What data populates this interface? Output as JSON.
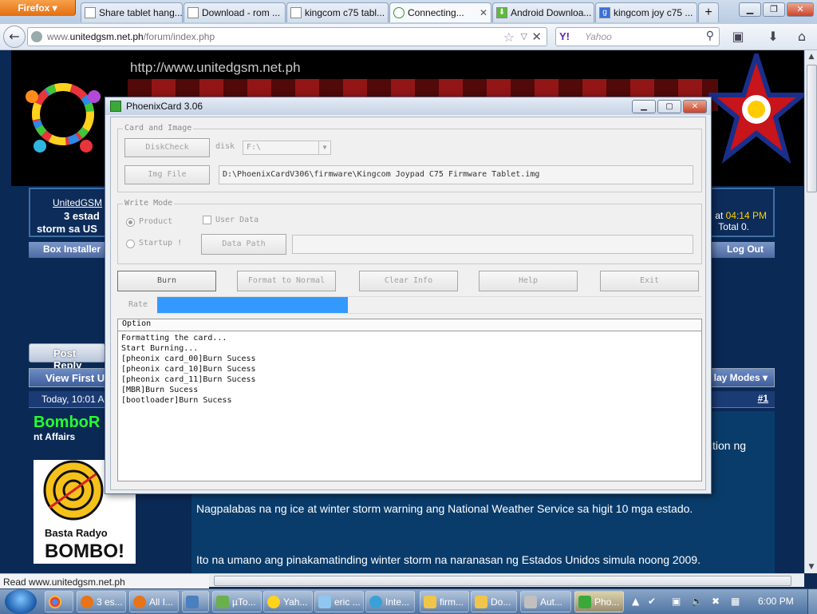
{
  "browser": {
    "app_button": "Firefox ▾",
    "tabs": [
      {
        "label": "Share tablet hang..."
      },
      {
        "label": "Download - rom ..."
      },
      {
        "label": "kingcom c75 tabl..."
      },
      {
        "label": "Connecting...",
        "active": true
      },
      {
        "label": "Android Downloa..."
      },
      {
        "label": "kingcom joy c75 ..."
      }
    ],
    "new_tab": "+",
    "url_prefix": "www.",
    "url_domain": "unitedgsm.net.ph",
    "url_suffix": "/forum/index.php",
    "search_engine": "Y!",
    "search_placeholder": "Yahoo",
    "status_text": "Read www.unitedgsm.net.ph"
  },
  "forum": {
    "site_url": "http://www.unitedgsm.net.ph",
    "breadcrumb_link": "UnitedGSM",
    "thread_title_1": "3 estad",
    "thread_title_2": "storm sa US",
    "time_prefix": "at",
    "time_value": "04:14 PM",
    "total_text": "Total 0.",
    "strip_left": "Box Installer",
    "strip_right": "Log Out",
    "post_reply": "Post Reply",
    "view_first": "View First U",
    "display_modes": "lay Modes ▾",
    "post_date": "Today, 10:01 AI",
    "post_number": "#1",
    "username": "BomboR",
    "user_title": "nt Affairs",
    "avatar_text_1": "Basta Radyo",
    "avatar_text_2": "BOMBO!",
    "post_fragment": "ction ng",
    "post_line_1": "Nagpalabas na ng ice at winter storm warning ang National Weather Service sa higit 10 mga estado.",
    "post_line_2": "Ito na umano ang pinakamatinding winter storm na naranasan ng Estados Unidos simula noong 2009."
  },
  "dialog": {
    "title": "PhoenixCard 3.06",
    "card_group": "Card and Image",
    "diskcheck": "DiskCheck",
    "disk_label": "disk",
    "disk_value": "F:\\",
    "img_file_btn": "Img File",
    "img_path": "D:\\PhoenixCardV306\\firmware\\Kingcom Joypad C75 Firmware Tablet.img",
    "write_mode_group": "Write Mode",
    "product": "Product",
    "user_data": "User Data",
    "startup": "Startup !",
    "data_path_btn": "Data Path",
    "burn": "Burn",
    "format": "Format to Normal",
    "clear": "Clear Info",
    "help": "Help",
    "exit": "Exit",
    "rate_label": "Rate",
    "rate_fraction": 0.35,
    "log_header": "Option",
    "log_lines": [
      "Formatting the card...",
      "Start Burning...",
      "[pheonix card_00]Burn Sucess",
      "[pheonix card_10]Burn Sucess",
      "[pheonix card_11]Burn Sucess",
      "[MBR]Burn Sucess",
      "[bootloader]Burn Sucess"
    ]
  },
  "taskbar": {
    "items": [
      {
        "label": "3 es..."
      },
      {
        "label": "All I..."
      },
      {
        "label": "µTo..."
      },
      {
        "label": "Yah..."
      },
      {
        "label": "eric ..."
      },
      {
        "label": "Inte..."
      },
      {
        "label": "firm..."
      },
      {
        "label": "Do..."
      },
      {
        "label": "Aut..."
      },
      {
        "label": "Pho..."
      }
    ],
    "clock": "6:00 PM"
  },
  "colors": {
    "page_bg": "#0b2955",
    "progress": "#3399ff",
    "username_green": "#25ff2f",
    "time_yellow": "#ffd200"
  }
}
